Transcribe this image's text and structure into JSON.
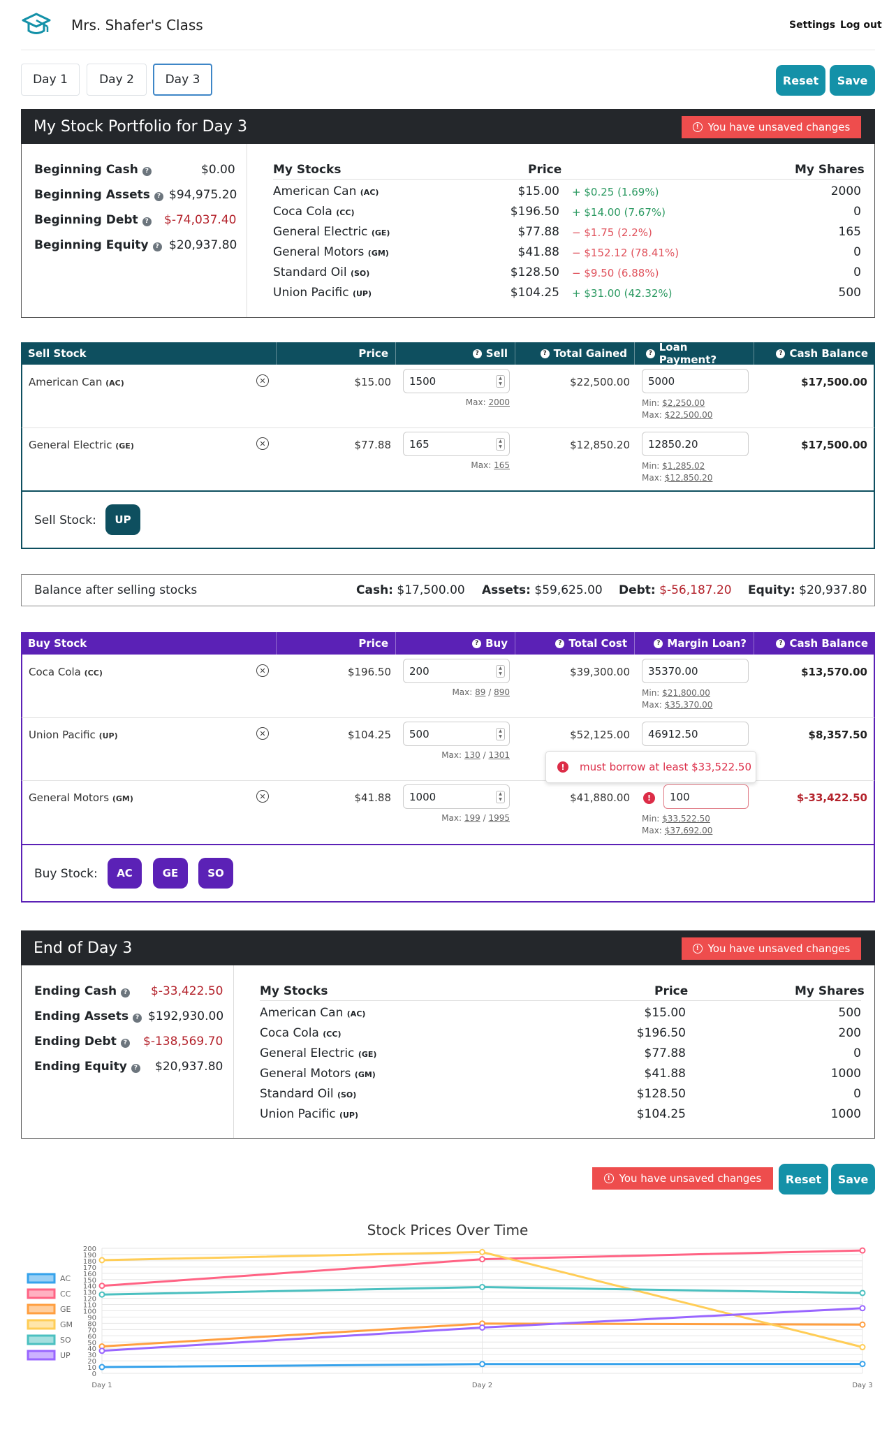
{
  "header": {
    "class_name": "Mrs. Shafer's Class",
    "settings": "Settings",
    "logout": "Log out"
  },
  "days": [
    "Day 1",
    "Day 2",
    "Day 3"
  ],
  "toolbar": {
    "reset": "Reset",
    "save": "Save",
    "unsaved": "You have unsaved changes"
  },
  "portfolio": {
    "title": "My Stock Portfolio for Day 3",
    "summary": [
      {
        "label": "Beginning Cash",
        "value": "$0.00"
      },
      {
        "label": "Beginning Assets",
        "value": "$94,975.20"
      },
      {
        "label": "Beginning Debt",
        "value": "$-74,037.40"
      },
      {
        "label": "Beginning Equity",
        "value": "$20,937.80"
      }
    ],
    "col_stocks": "My Stocks",
    "col_price": "Price",
    "col_shares": "My Shares",
    "stocks": [
      {
        "name": "American Can",
        "ticker": "(AC)",
        "price": "$15.00",
        "sign": "+",
        "change": "$0.25 (1.69%)",
        "shares": "2000"
      },
      {
        "name": "Coca Cola",
        "ticker": "(CC)",
        "price": "$196.50",
        "sign": "+",
        "change": "$14.00 (7.67%)",
        "shares": "0"
      },
      {
        "name": "General Electric",
        "ticker": "(GE)",
        "price": "$77.88",
        "sign": "−",
        "change": "$1.75 (2.2%)",
        "shares": "165"
      },
      {
        "name": "General Motors",
        "ticker": "(GM)",
        "price": "$41.88",
        "sign": "−",
        "change": "$152.12 (78.41%)",
        "shares": "0"
      },
      {
        "name": "Standard Oil",
        "ticker": "(SO)",
        "price": "$128.50",
        "sign": "−",
        "change": "$9.50 (6.88%)",
        "shares": "0"
      },
      {
        "name": "Union Pacific",
        "ticker": "(UP)",
        "price": "$104.25",
        "sign": "+",
        "change": "$31.00 (42.32%)",
        "shares": "500"
      }
    ]
  },
  "sell": {
    "headers": [
      "Sell Stock",
      "Price",
      "Sell",
      "Total Gained",
      "Loan Payment?",
      "Cash Balance"
    ],
    "rows": [
      {
        "name": "American Can",
        "ticker": "(AC)",
        "price": "$15.00",
        "qty": "1500",
        "max_label": "Max:",
        "max": "2000",
        "total": "$22,500.00",
        "loan": "5000",
        "min_label": "Min:",
        "min": "$2,250.00",
        "max2_label": "Max:",
        "max2": "$22,500.00",
        "balance": "$17,500.00"
      },
      {
        "name": "General Electric",
        "ticker": "(GE)",
        "price": "$77.88",
        "qty": "165",
        "max_label": "Max:",
        "max": "165",
        "total": "$12,850.20",
        "loan": "12850.20",
        "min_label": "Min:",
        "min": "$1,285.02",
        "max2_label": "Max:",
        "max2": "$12,850.20",
        "balance": "$17,500.00"
      }
    ],
    "footer_label": "Sell Stock:",
    "chips": [
      "UP"
    ]
  },
  "balance": {
    "label": "Balance after selling stocks",
    "cash_label": "Cash:",
    "cash": "$17,500.00",
    "assets_label": "Assets:",
    "assets": "$59,625.00",
    "debt_label": "Debt:",
    "debt": "$-56,187.20",
    "equity_label": "Equity:",
    "equity": "$20,937.80"
  },
  "buy": {
    "headers": [
      "Buy Stock",
      "Price",
      "Buy",
      "Total Cost",
      "Margin Loan?",
      "Cash Balance"
    ],
    "rows": [
      {
        "name": "Coca Cola",
        "ticker": "(CC)",
        "price": "$196.50",
        "qty": "200",
        "max_label": "Max:",
        "max_a": "89",
        "max_b": "890",
        "total": "$39,300.00",
        "loan": "35370.00",
        "min_label": "Min:",
        "min": "$21,800.00",
        "max2_label": "Max:",
        "max2": "$35,370.00",
        "balance": "$13,570.00"
      },
      {
        "name": "Union Pacific",
        "ticker": "(UP)",
        "price": "$104.25",
        "qty": "500",
        "max_label": "Max:",
        "max_a": "130",
        "max_b": "1301",
        "total": "$52,125.00",
        "loan": "46912.50",
        "balance": "$8,357.50"
      },
      {
        "name": "General Motors",
        "ticker": "(GM)",
        "price": "$41.88",
        "qty": "1000",
        "max_label": "Max:",
        "max_a": "199",
        "max_b": "1995",
        "total": "$41,880.00",
        "loan": "100",
        "min_label": "Min:",
        "min": "$33,522.50",
        "max2_label": "Max:",
        "max2": "$37,692.00",
        "balance": "$-33,422.50"
      }
    ],
    "error_popup": "must borrow at least $33,522.50",
    "footer_label": "Buy Stock:",
    "chips": [
      "AC",
      "GE",
      "SO"
    ]
  },
  "end": {
    "title": "End of Day 3",
    "summary": [
      {
        "label": "Ending Cash",
        "value": "$-33,422.50"
      },
      {
        "label": "Ending Assets",
        "value": "$192,930.00"
      },
      {
        "label": "Ending Debt",
        "value": "$-138,569.70"
      },
      {
        "label": "Ending Equity",
        "value": "$20,937.80"
      }
    ],
    "col_stocks": "My Stocks",
    "col_price": "Price",
    "col_shares": "My Shares",
    "stocks": [
      {
        "name": "American Can",
        "ticker": "(AC)",
        "price": "$15.00",
        "shares": "500"
      },
      {
        "name": "Coca Cola",
        "ticker": "(CC)",
        "price": "$196.50",
        "shares": "200"
      },
      {
        "name": "General Electric",
        "ticker": "(GE)",
        "price": "$77.88",
        "shares": "0"
      },
      {
        "name": "General Motors",
        "ticker": "(GM)",
        "price": "$41.88",
        "shares": "1000"
      },
      {
        "name": "Standard Oil",
        "ticker": "(SO)",
        "price": "$128.50",
        "shares": "0"
      },
      {
        "name": "Union Pacific",
        "ticker": "(UP)",
        "price": "$104.25",
        "shares": "1000"
      }
    ]
  },
  "colors": {
    "teal": "#1491a8",
    "sell_header": "#0e4f5f",
    "buy_header": "#5b21b6",
    "warning": "#ee4d4d",
    "dark_header": "#24272b",
    "negative": "#b4232c"
  },
  "chart_data": {
    "type": "line",
    "title": "Stock Prices Over Time",
    "x": [
      "Day 1",
      "Day 2",
      "Day 3"
    ],
    "ylim": [
      0,
      200
    ],
    "yticks": [
      0,
      10,
      20,
      30,
      40,
      50,
      60,
      70,
      80,
      90,
      100,
      110,
      120,
      130,
      140,
      150,
      160,
      170,
      180,
      190,
      200
    ],
    "grid": true,
    "legend": "left",
    "series": [
      {
        "name": "AC",
        "color": "#36a2eb",
        "values": [
          10,
          14.75,
          15
        ]
      },
      {
        "name": "CC",
        "color": "#ff6384",
        "values": [
          140,
          182.5,
          196.5
        ]
      },
      {
        "name": "GE",
        "color": "#ff9f40",
        "values": [
          43,
          79.63,
          77.88
        ]
      },
      {
        "name": "GM",
        "color": "#ffcd56",
        "values": [
          181,
          194,
          41.88
        ]
      },
      {
        "name": "SO",
        "color": "#4bc0c0",
        "values": [
          126,
          138,
          128.5
        ]
      },
      {
        "name": "UP",
        "color": "#9966ff",
        "values": [
          36,
          73.25,
          104.25
        ]
      }
    ]
  }
}
